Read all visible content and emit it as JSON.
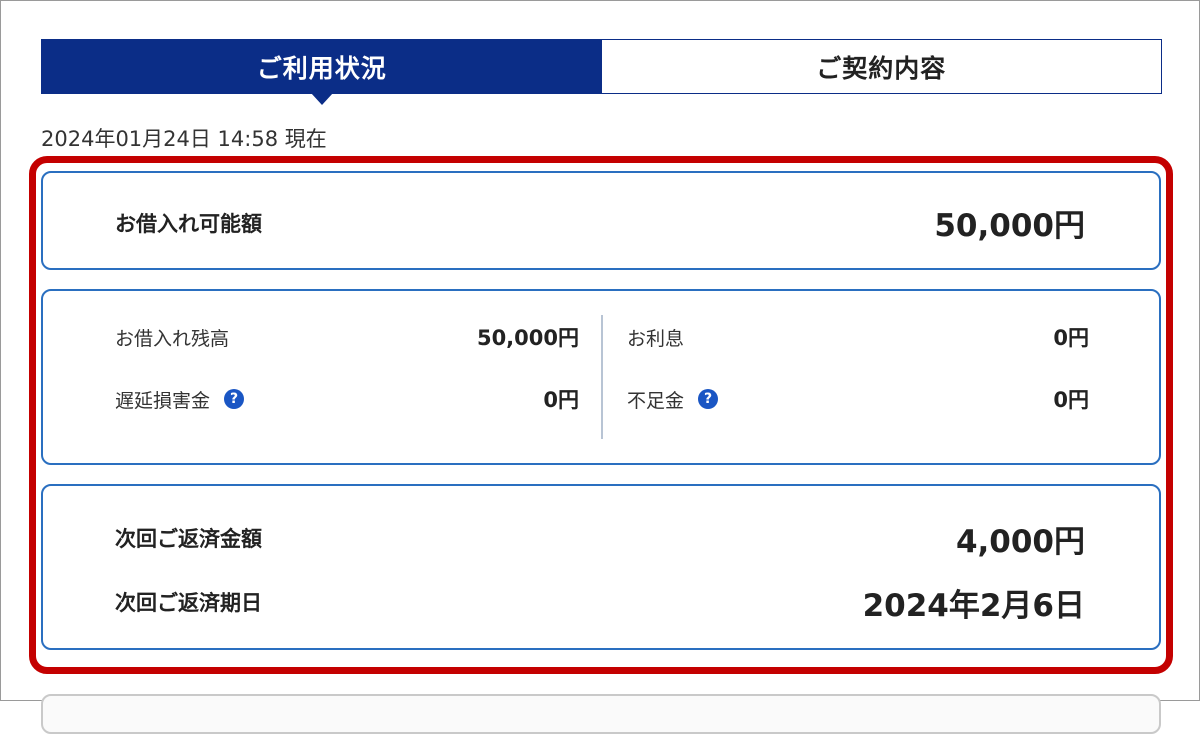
{
  "tabs": [
    {
      "label": "ご利用状況",
      "active": true
    },
    {
      "label": "ご契約内容",
      "active": false
    }
  ],
  "timestamp": "2024年01月24日 14:58 現在",
  "available": {
    "label": "お借入れ可能額",
    "value": "50,000円"
  },
  "details": {
    "balance_label": "お借入れ残高",
    "balance_value": "50,000円",
    "late_fee_label": "遅延損害金",
    "late_fee_value": "0円",
    "interest_label": "お利息",
    "interest_value": "0円",
    "shortfall_label": "不足金",
    "shortfall_value": "0円"
  },
  "repayment": {
    "amount_label": "次回ご返済金額",
    "amount_value": "4,000円",
    "date_label": "次回ご返済期日",
    "date_value": "2024年2月6日"
  },
  "icons": {
    "help": "?"
  },
  "colors": {
    "navy": "#0b2d87",
    "card_border": "#2a6fc0",
    "highlight": "#c40000",
    "help_icon": "#1a56c4"
  }
}
